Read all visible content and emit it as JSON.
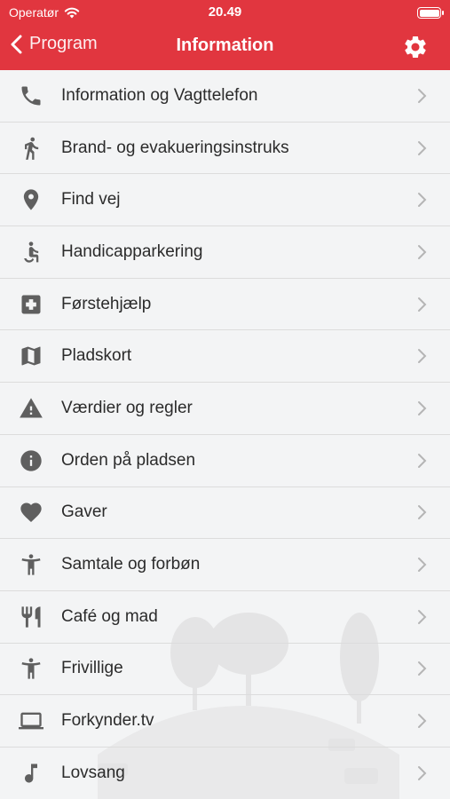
{
  "status_bar": {
    "carrier": "Operatør",
    "time": "20.49"
  },
  "navbar": {
    "back_label": "Program",
    "title": "Information"
  },
  "items": [
    {
      "label": "Information og Vagttelefon",
      "icon": "phone-icon"
    },
    {
      "label": "Brand- og evakueringsinstruks",
      "icon": "running-person-icon"
    },
    {
      "label": "Find vej",
      "icon": "map-pin-icon"
    },
    {
      "label": "Handicapparkering",
      "icon": "wheelchair-icon"
    },
    {
      "label": "Førstehjælp",
      "icon": "first-aid-icon"
    },
    {
      "label": "Pladskort",
      "icon": "map-icon"
    },
    {
      "label": "Værdier og regler",
      "icon": "warning-icon"
    },
    {
      "label": "Orden på pladsen",
      "icon": "info-icon"
    },
    {
      "label": "Gaver",
      "icon": "heart-icon"
    },
    {
      "label": "Samtale og forbøn",
      "icon": "person-icon"
    },
    {
      "label": "Café og mad",
      "icon": "cutlery-icon"
    },
    {
      "label": "Frivillige",
      "icon": "person-icon"
    },
    {
      "label": "Forkynder.tv",
      "icon": "laptop-icon"
    },
    {
      "label": "Lovsang",
      "icon": "music-note-icon"
    }
  ],
  "colors": {
    "header": "#e1363f",
    "icon": "#5f5f5f",
    "chevron": "#b5b5b5",
    "background": "#f3f4f5"
  }
}
